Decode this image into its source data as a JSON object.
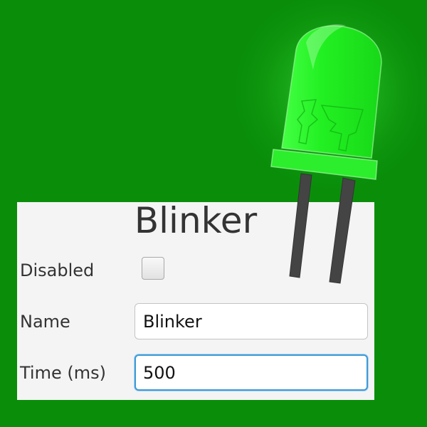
{
  "window": {
    "title": "Blinker",
    "background_color": "#0a8e0a"
  },
  "form": {
    "disabled": {
      "label": "Disabled",
      "checked": false
    },
    "name": {
      "label": "Name",
      "value": "Blinker"
    },
    "time": {
      "label": "Time (ms)",
      "value": "500",
      "focused": true
    }
  },
  "led": {
    "icon": "led-bulb-icon",
    "state": "on",
    "color": "#22f022"
  }
}
